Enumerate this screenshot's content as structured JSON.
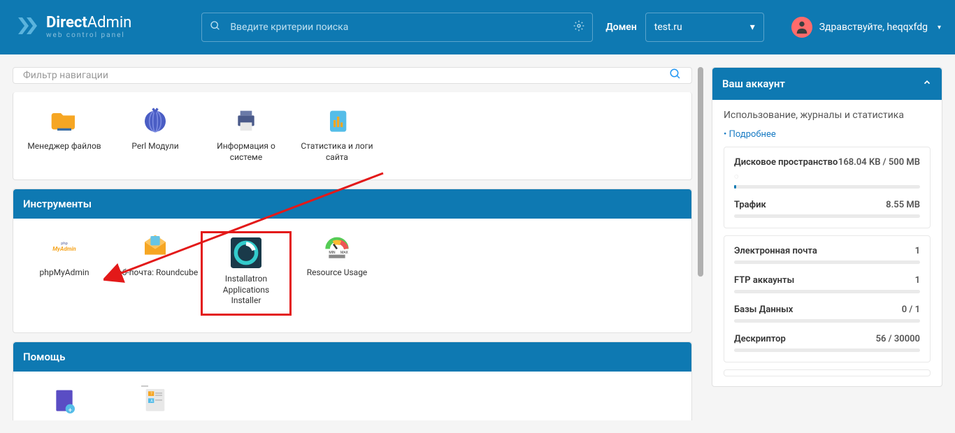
{
  "header": {
    "logo_title_bold": "Direct",
    "logo_title_rest": "Admin",
    "logo_subtitle": "web control panel",
    "search_placeholder": "Введите критерии поиска",
    "domain_label": "Домен",
    "domain_selected": "test.ru",
    "greeting_prefix": "Здравствуйте, ",
    "username": "heqqxfdg"
  },
  "filter": {
    "placeholder": "Фильтр навигации"
  },
  "top_tiles": [
    {
      "label": "Менеджер файлов"
    },
    {
      "label": "Perl Модули"
    },
    {
      "label": "Информация о системе"
    },
    {
      "label": "Статистика и логи сайта"
    }
  ],
  "sections": {
    "tools_title": "Инструменты",
    "tools_items": [
      {
        "label": "phpMyAdmin"
      },
      {
        "label": "Вэб-почта: Roundcube"
      },
      {
        "label": "Installatron Applications Installer"
      },
      {
        "label": "Resource Usage"
      }
    ],
    "help_title": "Помощь"
  },
  "sidebar": {
    "account_title": "Ваш аккаунт",
    "account_subtitle": "Использование, журналы и статистика",
    "more_link": "• Подробнее",
    "stats1": [
      {
        "name": "Дисковое пространство",
        "value": "168.04 KB / 500 MB"
      },
      {
        "name": "Трафик",
        "value": "8.55 MB"
      }
    ],
    "stats2": [
      {
        "name": "Электронная почта",
        "value": "1"
      },
      {
        "name": "FTP аккаунты",
        "value": "1"
      },
      {
        "name": "Базы Данных",
        "value": "0 / 1"
      },
      {
        "name": "Дескриптор",
        "value": "56 / 30000"
      }
    ]
  }
}
